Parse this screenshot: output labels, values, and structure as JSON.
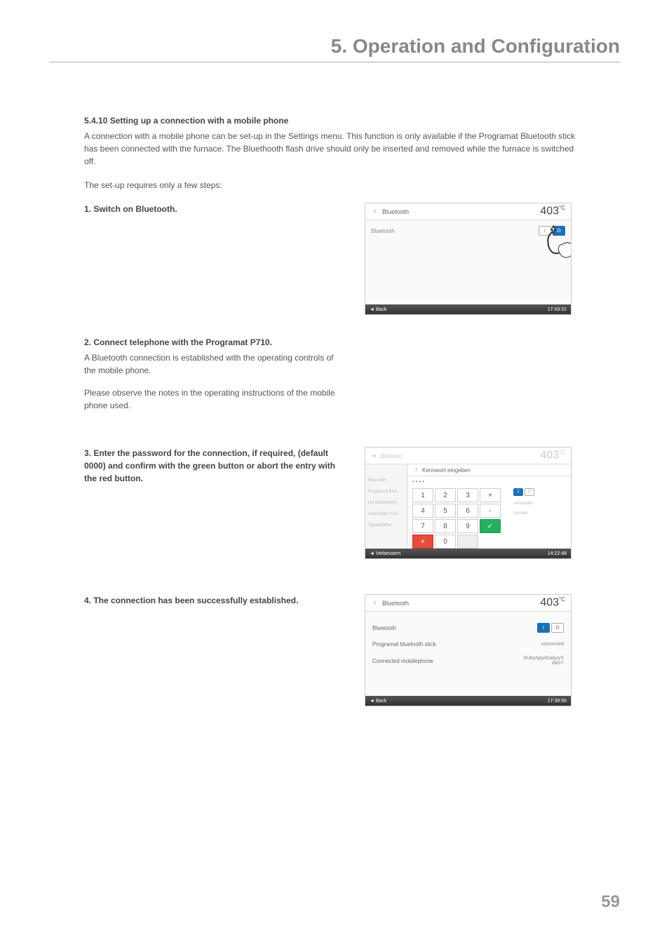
{
  "chapter": {
    "title": "5. Operation and Configuration"
  },
  "section": {
    "heading": "5.4.10 Setting up a connection with a mobile phone",
    "intro1": "A connection with a mobile phone can be set-up in the Settings menu. This function is only available if the Programat Bluetooth stick has been connected with the furnace. The Bluethooth flash drive should only be inserted and removed while the furnace is switched off.",
    "intro2": "The set-up requires only a few steps:"
  },
  "steps": {
    "s1": {
      "title": "1. Switch on Bluetooth."
    },
    "s2": {
      "title": "2. Connect telephone with the Programat P710.",
      "text1": "A Bluetooth connection is established with the operating controls of the mobile phone.",
      "text2": "Please observe the notes in the operating instructions of the mobile phone used."
    },
    "s3": {
      "title": "3. Enter the password for the connection, if required, (default 0000) and confirm with the green button or abort the entry with the red button."
    },
    "s4": {
      "title": "4. The connection has been successfully established."
    }
  },
  "screenshots": {
    "img1": {
      "header_label": "Bluetooth",
      "temp": "403",
      "temp_unit": "°C",
      "body_label": "Bluetooth",
      "toggle_on": "I",
      "toggle_off": "O",
      "footer_back": "◄ Back",
      "footer_time": "17:43:31"
    },
    "img2": {
      "header_label": "Bluetoo",
      "header_prompt": "Kennwort eingeben",
      "temp": "403",
      "temp_unit": "°C",
      "dots": "••••",
      "sidebar_items": [
        "Bluetooth",
        "Programat Blue",
        "not Mobitelefon",
        "verbunden m-ID",
        "Signalstärke"
      ],
      "keys": [
        "1",
        "2",
        "3",
        "+",
        "4",
        "5",
        "6",
        "-",
        "7",
        "8",
        "9",
        "",
        "×",
        "0",
        "",
        "✓"
      ],
      "right_toggle_on": "I",
      "right_toggle_off": "O",
      "right_status1": "verbunden",
      "right_status2": "Suchen",
      "footer_back": "◄ Verbessern",
      "footer_time": "14:22:48"
    },
    "img3": {
      "header_label": "Bluetooth",
      "temp": "403",
      "temp_unit": "°C",
      "row1_label": "Bluetooth",
      "toggle_on": "I",
      "toggle_off": "O",
      "row2_label": "Programat bluetooth stick",
      "row2_status": "connected",
      "row3_label": "Connected mobilephone",
      "row3_status": "RubyApp/GalaxyS\nilikoY",
      "footer_back": "◄ Back",
      "footer_time": "17:39:56"
    }
  },
  "page_number": "59"
}
